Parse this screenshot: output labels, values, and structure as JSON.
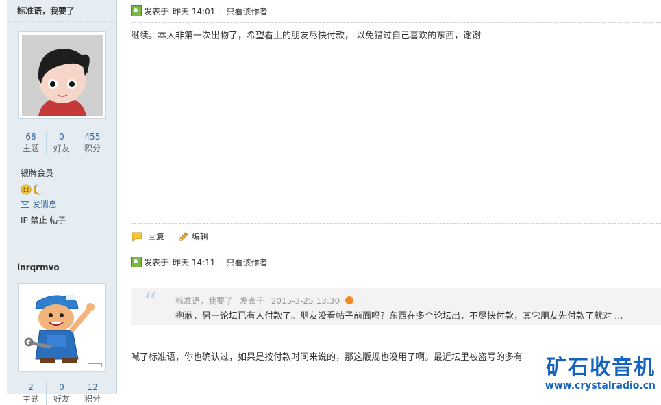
{
  "author1": {
    "name": "标准语，我要了",
    "stats": [
      {
        "num": "68",
        "label": "主题"
      },
      {
        "num": "0",
        "label": "好友"
      },
      {
        "num": "455",
        "label": "积分"
      }
    ],
    "rank": "银牌会员",
    "send_message": "发消息",
    "admin_links": "IP 禁止 帖子"
  },
  "author2": {
    "name": "inrqrmvo",
    "stats": [
      {
        "num": "2",
        "label": "主题"
      },
      {
        "num": "0",
        "label": "好友"
      },
      {
        "num": "12",
        "label": "积分"
      }
    ]
  },
  "post1": {
    "posted_at_prefix": "发表于",
    "posted_at": "昨天 14:01",
    "only_author": "只看该作者",
    "content": "继续。本人非第一次出物了，希望看上的朋友尽快付款， 以免错过自己喜欢的东西，谢谢",
    "reply_label": "回复",
    "edit_label": "编辑"
  },
  "post2": {
    "posted_at_prefix": "发表于",
    "posted_at": "昨天 14:11",
    "only_author": "只看该作者",
    "quote_author": "标准语，我要了",
    "quote_posted_prefix": "发表于",
    "quote_posted_at": "2015-3-25 13:30",
    "quote_text": "抱歉，另一论坛已有人付款了。朋友没看帖子前面吗？东西在多个论坛出，不尽快付款，其它朋友先付款了就对 ...",
    "content": "喊了标准语，你也确认过，如果是按付款时间来说的，那这版规也没用了啊。最近坛里被盗号的多有"
  },
  "watermark": {
    "cn": "矿石收音机",
    "url": "www.crystalradio.cn"
  },
  "colors": {
    "sidebar_bg": "#e5edf2",
    "link_blue": "#336699",
    "watermark_blue": "#1565c0"
  }
}
